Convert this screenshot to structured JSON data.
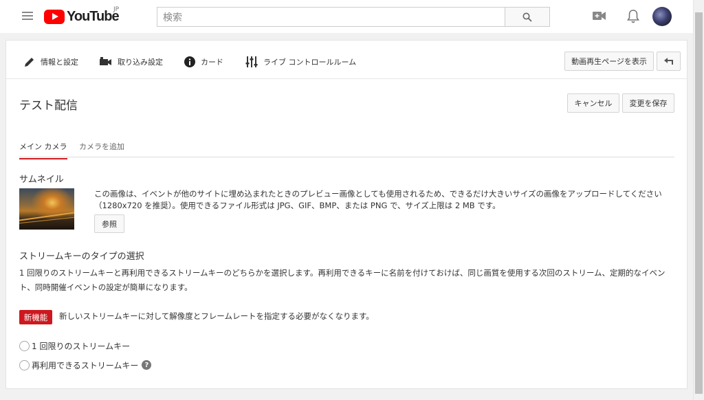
{
  "masthead": {
    "logo_text": "YouTube",
    "logo_region": "JP",
    "search_placeholder": "検索"
  },
  "toolbar": {
    "items": [
      {
        "label": "情報と設定",
        "icon": "pencil-icon"
      },
      {
        "label": "取り込み設定",
        "icon": "video-camera-icon"
      },
      {
        "label": "カード",
        "icon": "info-icon"
      },
      {
        "label": "ライブ コントロールルーム",
        "icon": "sliders-icon"
      }
    ],
    "view_watch_page": "動画再生ページを表示",
    "back_icon": "back-arrow-icon"
  },
  "page": {
    "title": "テスト配信",
    "cancel": "キャンセル",
    "save": "変更を保存"
  },
  "tabs": [
    {
      "label": "メイン カメラ",
      "active": true
    },
    {
      "label": "カメラを追加",
      "active": false
    }
  ],
  "thumbnail": {
    "label": "サムネイル",
    "description": "この画像は、イベントが他のサイトに埋め込まれたときのプレビュー画像としても使用されるため、できるだけ大きいサイズの画像をアップロードしてください（1280x720 を推奨）。使用できるファイル形式は JPG、GIF、BMP、または PNG で、サイズ上限は 2 MB です。",
    "browse": "参照"
  },
  "stream_key": {
    "heading": "ストリームキーのタイプの選択",
    "description": "1 回限りのストリームキーと再利用できるストリームキーのどちらかを選択します。再利用できるキーに名前を付けておけば、同じ画質を使用する次回のストリーム、定期的なイベント、同時開催イベントの設定が簡単になります。",
    "badge": "新機能",
    "badge_text": "新しいストリームキーに対して解像度とフレームレートを指定する必要がなくなります。",
    "options": [
      {
        "label": "1 回限りのストリームキー"
      },
      {
        "label": "再利用できるストリームキー"
      }
    ]
  },
  "colors": {
    "accent": "#cc181e",
    "logo_red": "#ff0000"
  }
}
